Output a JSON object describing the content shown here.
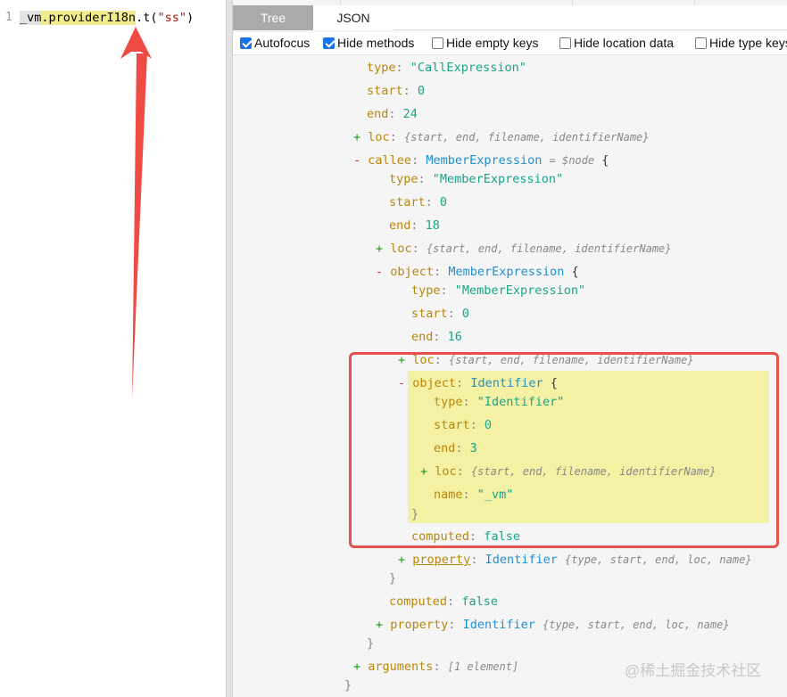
{
  "editor": {
    "line_number": "1",
    "code": {
      "part_a": "_vm",
      "dot1": ".",
      "part_b": "providerI18n",
      "rest": ".t(",
      "string": "\"ss\"",
      "close": ")"
    }
  },
  "tabs": {
    "tree": "Tree",
    "json": "JSON"
  },
  "options": [
    {
      "label": "Autofocus",
      "checked": true
    },
    {
      "label": "Hide methods",
      "checked": true
    },
    {
      "label": "Hide empty keys",
      "checked": false
    },
    {
      "label": "Hide location data",
      "checked": false
    },
    {
      "label": "Hide type keys",
      "checked": false
    }
  ],
  "tree": {
    "plus": "+",
    "minus": "-",
    "colon": ":",
    "open_brace": "{",
    "close_brace": "}",
    "loc_summary": "{start, end, filename, identifierName}",
    "id_summary": "{type, start, end, loc, name}",
    "root_type_key": "type",
    "root_type_val": "\"CallExpression\"",
    "root_start_key": "start",
    "root_start_val": "0",
    "root_end_key": "end",
    "root_end_val": "24",
    "loc_key": "loc",
    "callee_key": "callee",
    "callee_type": "MemberExpression",
    "node_marker": "= $node",
    "callee_type_key": "type",
    "callee_type_val": "\"MemberExpression\"",
    "callee_start_key": "start",
    "callee_start_val": "0",
    "callee_end_key": "end",
    "callee_end_val": "18",
    "obj_key": "object",
    "obj_type": "MemberExpression",
    "obj_type_key": "type",
    "obj_type_val": "\"MemberExpression\"",
    "obj_start_key": "start",
    "obj_start_val": "0",
    "obj_end_key": "end",
    "obj_end_val": "16",
    "inner_obj_key": "object",
    "inner_obj_type": "Identifier",
    "id_type_key": "type",
    "id_type_val": "\"Identifier\"",
    "id_start_key": "start",
    "id_start_val": "0",
    "id_end_key": "end",
    "id_end_val": "3",
    "id_name_key": "name",
    "id_name_val": "\"_vm\"",
    "computed_key": "computed",
    "computed_val": "false",
    "property_key": "property",
    "property_type": "Identifier",
    "arguments_key": "arguments",
    "arguments_summary": "[1 element]"
  },
  "watermark": "@稀土掘金技术社区"
}
